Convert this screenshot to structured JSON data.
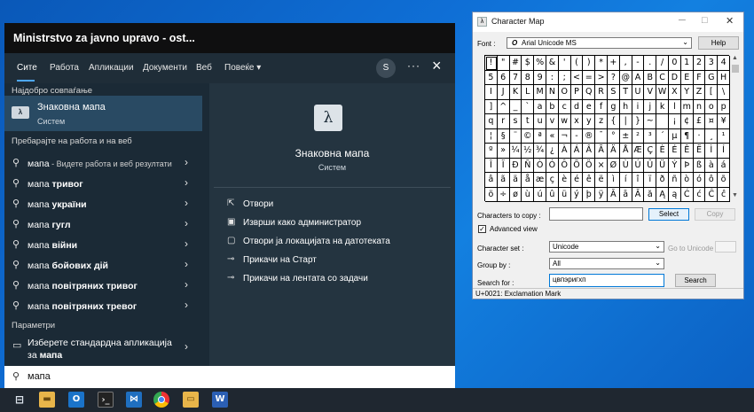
{
  "start_menu": {
    "title": "Ministrstvo za javno upravo - ost...",
    "tabs": [
      "Сите",
      "Работа",
      "Апликации",
      "Документи",
      "Веб",
      "Повеќе ▾"
    ],
    "avatar": "S",
    "best_match_header": "Најдобро совпаѓање",
    "best_match": {
      "title": "Знаковна мапа",
      "subtitle": "Систем"
    },
    "web_header": "Пребарајте на работа и на веб",
    "suggestions": [
      {
        "prefix": "мапа",
        "bold": "",
        "desc": " - Видете работа и веб резултати"
      },
      {
        "prefix": "мапа ",
        "bold": "тривог",
        "desc": ""
      },
      {
        "prefix": "мапа ",
        "bold": "україни",
        "desc": ""
      },
      {
        "prefix": "мапа ",
        "bold": "гугл",
        "desc": ""
      },
      {
        "prefix": "мапа ",
        "bold": "війни",
        "desc": ""
      },
      {
        "prefix": "мапа ",
        "bold": "бойових дій",
        "desc": ""
      },
      {
        "prefix": "мапа ",
        "bold": "повітряних тривог",
        "desc": ""
      },
      {
        "prefix": "мапа ",
        "bold": "повітряних тревог",
        "desc": ""
      }
    ],
    "settings_header": "Параметри",
    "settings_item": {
      "line1": "Изберете стандардна апликација",
      "line2_prefix": "за ",
      "line2_bold": "мапа"
    },
    "preview": {
      "title": "Знаковна мапа",
      "subtitle": "Систем",
      "actions": [
        {
          "icon": "open-icon",
          "label": "Отвори"
        },
        {
          "icon": "admin-icon",
          "label": "Изврши како администратор"
        },
        {
          "icon": "folder-icon",
          "label": "Отвори ја локацијата на датотеката"
        },
        {
          "icon": "pin-icon",
          "label": "Прикачи на Старт"
        },
        {
          "icon": "taskbar-pin-icon",
          "label": "Прикачи на лентата со задачи"
        }
      ]
    },
    "search_value": "мапа"
  },
  "taskbar": {
    "items": [
      "task-view",
      "file-explorer",
      "outlook",
      "terminal",
      "vscode",
      "chrome",
      "files",
      "word"
    ]
  },
  "charmap": {
    "title": "Character Map",
    "font_label": "Font :",
    "font_value": "Arial Unicode MS",
    "help_label": "Help",
    "chars_to_copy_label": "Characters to copy :",
    "select_label": "Select",
    "copy_label": "Copy",
    "advanced_view_label": "Advanced view",
    "advanced_view_checked": true,
    "charset_label": "Character set :",
    "charset_value": "Unicode",
    "goto_unicode_label": "Go to Unicode :",
    "group_by_label": "Group by :",
    "group_by_value": "All",
    "search_for_label": "Search for :",
    "search_for_value": "цвпэригхп",
    "search_label": "Search",
    "status": "U+0021: Exclamation Mark",
    "grid_rows": [
      [
        "!",
        "\"",
        "#",
        "$",
        "%",
        "&",
        "'",
        "(",
        ")",
        "*",
        "+",
        ",",
        "-",
        ".",
        "/",
        "0",
        "1",
        "2",
        "3",
        "4"
      ],
      [
        "5",
        "6",
        "7",
        "8",
        "9",
        ":",
        ";",
        "<",
        "=",
        ">",
        "?",
        "@",
        "A",
        "B",
        "C",
        "D",
        "E",
        "F",
        "G",
        "H"
      ],
      [
        "I",
        "J",
        "K",
        "L",
        "M",
        "N",
        "O",
        "P",
        "Q",
        "R",
        "S",
        "T",
        "U",
        "V",
        "W",
        "X",
        "Y",
        "Z",
        "[",
        "\\"
      ],
      [
        "]",
        "^",
        "_",
        "`",
        "a",
        "b",
        "c",
        "d",
        "e",
        "f",
        "g",
        "h",
        "i",
        "j",
        "k",
        "l",
        "m",
        "n",
        "o",
        "p"
      ],
      [
        "q",
        "r",
        "s",
        "t",
        "u",
        "v",
        "w",
        "x",
        "y",
        "z",
        "{",
        "|",
        "}",
        "~",
        " ",
        "¡",
        "¢",
        "£",
        "¤",
        "¥"
      ],
      [
        "¦",
        "§",
        "¨",
        "©",
        "ª",
        "«",
        "¬",
        "-",
        "®",
        "¯",
        "°",
        "±",
        "²",
        "³",
        "´",
        "µ",
        "¶",
        "·",
        "¸",
        "¹"
      ],
      [
        "º",
        "»",
        "¼",
        "½",
        "¾",
        "¿",
        "À",
        "Á",
        "Â",
        "Ã",
        "Ä",
        "Å",
        "Æ",
        "Ç",
        "È",
        "É",
        "Ê",
        "Ë",
        "Ì",
        "Í"
      ],
      [
        "Î",
        "Ï",
        "Ð",
        "Ñ",
        "Ò",
        "Ó",
        "Ô",
        "Õ",
        "Ö",
        "×",
        "Ø",
        "Ù",
        "Ú",
        "Û",
        "Ü",
        "Ý",
        "Þ",
        "ß",
        "à",
        "á"
      ],
      [
        "â",
        "ã",
        "ä",
        "å",
        "æ",
        "ç",
        "è",
        "é",
        "ê",
        "ë",
        "ì",
        "í",
        "î",
        "ï",
        "ð",
        "ñ",
        "ò",
        "ó",
        "ô",
        "õ"
      ],
      [
        "ö",
        "÷",
        "ø",
        "ù",
        "ú",
        "û",
        "ü",
        "ý",
        "þ",
        "ÿ",
        "Ā",
        "ā",
        "Ă",
        "ă",
        "Ą",
        "ą",
        "Ć",
        "ć",
        "Ĉ",
        "ĉ"
      ]
    ]
  }
}
